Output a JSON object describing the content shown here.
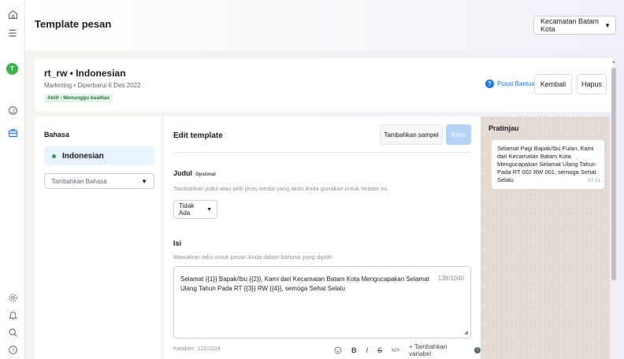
{
  "header": {
    "title": "Template pesan",
    "region_selector": "Kecamatan Batam Kota"
  },
  "template": {
    "name": "rt_rw • Indonesian",
    "meta": "Marketing • Diperbarui 6 Des 2022",
    "status": "Aktif - Menunggu kualitas",
    "help_label": "Pusat Bantuan",
    "back_label": "Kembali",
    "delete_label": "Hapus"
  },
  "language": {
    "heading": "Bahasa",
    "selected": "Indonesian",
    "add_placeholder": "Tambahkan Bahasa"
  },
  "editor": {
    "heading": "Edit template",
    "add_sample_label": "Tambahkan sampel",
    "send_label": "Kirim",
    "title_field": {
      "label": "Judul",
      "optional_tag": "Opsional",
      "description": "Tambahkan judul atau pilih jenis media yang akan Anda gunakan untuk header ini.",
      "selected": "Tidak Ada"
    },
    "body_field": {
      "label": "Isi",
      "description": "Masukkan teks untuk pesan Anda dalam bahasa yang dipilih.",
      "value": "Selamat {{1}} Bapak/Ibu {{2}}, Kami dari Kecamatan Batam Kota Mengucapakan Selamat Ulang Tahun Pada RT {{3}} RW {{4}}, semoga Sehat Selalu",
      "count": "138/1040"
    },
    "char_count": "Karakter: 122/1024",
    "toolbar": {
      "bold": "B",
      "italic": "I",
      "strike": "S",
      "code": "</>",
      "add_variable": "+ Tambahkan variabel"
    }
  },
  "preview": {
    "heading": "Pratinjau",
    "message": "Selamat Pagi Bapak/Ibu Fulan, Kami dari Kecamatan Batam Kota Mengucapakan Selamat Ulang Tahun Pada RT 002 RW 001, semoga Sehat Selalu",
    "time": "07.51"
  },
  "icons": [
    "home-icon",
    "menu-icon",
    "avatar",
    "speedometer-icon",
    "briefcase-icon",
    "settings-icon",
    "bell-icon",
    "search-icon",
    "help-icon"
  ],
  "colors": {
    "accent": "#1877f2",
    "status_green": "#1e7a34",
    "preview_bg": "#e5ddd5",
    "avatar": "#3ab54a"
  }
}
